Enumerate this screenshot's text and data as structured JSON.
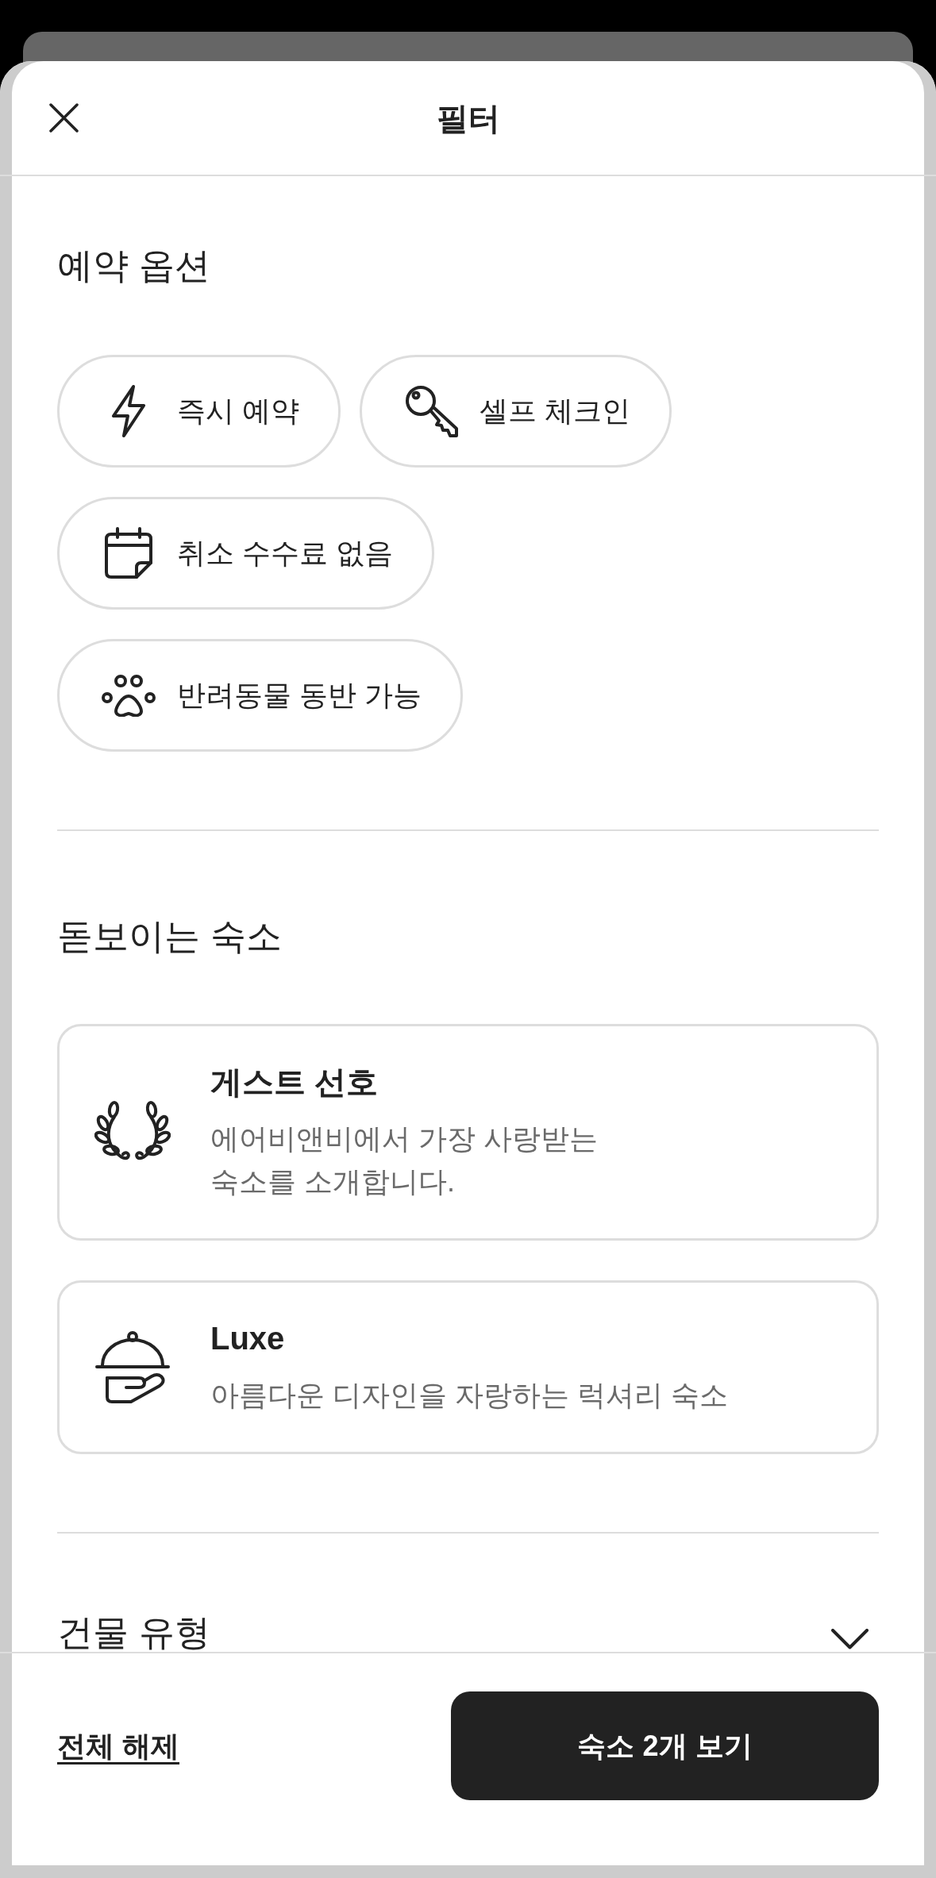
{
  "header": {
    "title": "필터"
  },
  "sections": [
    {
      "kind": "chips",
      "heading": "예약 옵션",
      "options": [
        {
          "label": "즉시 예약",
          "selected": false
        },
        {
          "label": "셀프 체크인",
          "selected": false
        },
        {
          "label": "취소 수수료 없음",
          "selected": false
        },
        {
          "label": "반려동물 동반 가능",
          "selected": false
        }
      ]
    },
    {
      "kind": "cards",
      "heading": "돋보이는 숙소",
      "cards": [
        {
          "title": "게스트 선호",
          "description": "에어비앤비에서 가장 사랑받는\n숙소를 소개합니다.",
          "selected": false
        },
        {
          "title": "Luxe",
          "description": "아름다운 디자인을 자랑하는 럭셔리 숙소",
          "selected": false
        }
      ]
    },
    {
      "kind": "collapsible",
      "heading": "건물 유형",
      "expanded": false
    }
  ],
  "footer": {
    "clear_all": "전체 해제",
    "show_results": "숙소 2개 보기"
  }
}
